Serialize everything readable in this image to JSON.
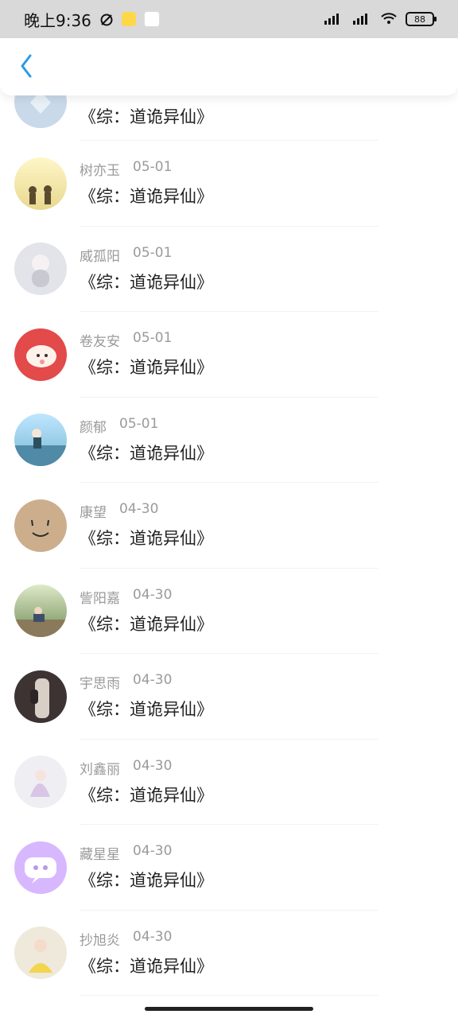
{
  "status": {
    "time": "晚上9:36",
    "battery": "88"
  },
  "header": {
    "back_label": ""
  },
  "list": {
    "items": [
      {
        "name": "",
        "date": "",
        "title": "《综：道诡异仙》",
        "avatar_color": "#c9d9ea"
      },
      {
        "name": "树亦玉",
        "date": "05-01",
        "title": "《综：道诡异仙》",
        "avatar_color": "#f4e7a8"
      },
      {
        "name": "威孤阳",
        "date": "05-01",
        "title": "《综：道诡异仙》",
        "avatar_color": "#d8d8de"
      },
      {
        "name": "卷友安",
        "date": "05-01",
        "title": "《综：道诡异仙》",
        "avatar_color": "#e34a4a"
      },
      {
        "name": "颜郁",
        "date": "05-01",
        "title": "《综：道诡异仙》",
        "avatar_color": "#9ed0e6"
      },
      {
        "name": "康望",
        "date": "04-30",
        "title": "《综：道诡异仙》",
        "avatar_color": "#ccae8d"
      },
      {
        "name": "訾阳嘉",
        "date": "04-30",
        "title": "《综：道诡异仙》",
        "avatar_color": "#5e7b4c"
      },
      {
        "name": "宇思雨",
        "date": "04-30",
        "title": "《综：道诡异仙》",
        "avatar_color": "#4a3e3e"
      },
      {
        "name": "刘鑫丽",
        "date": "04-30",
        "title": "《综：道诡异仙》",
        "avatar_color": "#e9e4ef"
      },
      {
        "name": "藏星星",
        "date": "04-30",
        "title": "《综：道诡异仙》",
        "avatar_color": "#d5b4ff"
      },
      {
        "name": "抄旭炎",
        "date": "04-30",
        "title": "《综：道诡异仙》",
        "avatar_color": "#e8e3d1"
      }
    ]
  }
}
